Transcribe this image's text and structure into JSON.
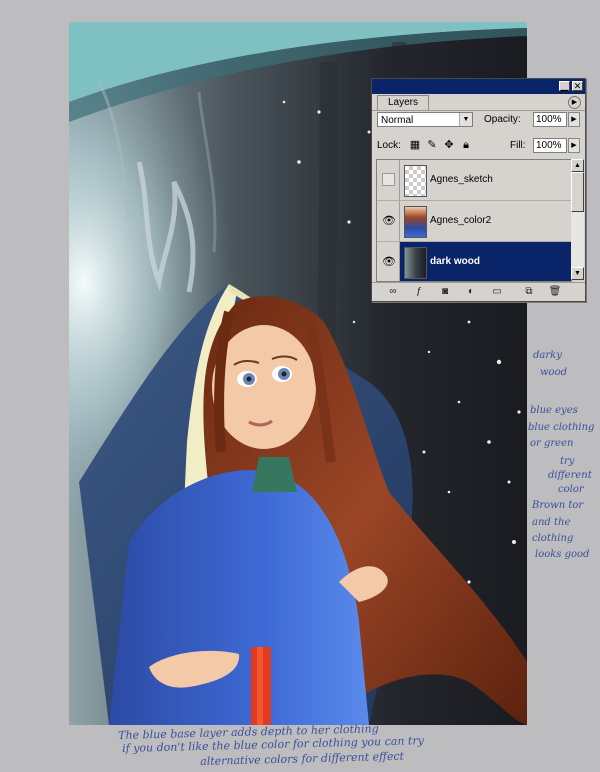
{
  "layers_panel": {
    "tab_label": "Layers",
    "blend_mode": "Normal",
    "opacity_label": "Opacity:",
    "opacity_value": "100%",
    "lock_label": "Lock:",
    "fill_label": "Fill:",
    "fill_value": "100%",
    "layers": [
      {
        "name": "Agnes_sketch",
        "visible": false,
        "selected": false,
        "thumb": "checker"
      },
      {
        "name": "Agnes_color2",
        "visible": true,
        "selected": false,
        "thumb": "portrait"
      },
      {
        "name": "dark wood",
        "visible": true,
        "selected": true,
        "thumb": "forest"
      }
    ],
    "footer_icons": [
      "link-icon",
      "layer-style-icon",
      "mask-icon",
      "adjustment-icon",
      "folder-icon",
      "new-layer-icon",
      "trash-icon"
    ]
  },
  "side_notes": [
    "darky",
    "wood",
    "blue eyes",
    "blue clothing",
    "or green",
    "try",
    "different",
    "color",
    "Brown tor",
    "and the",
    "clothing",
    "looks good"
  ],
  "bottom_notes": [
    "The blue base layer adds depth to her clothing",
    "if you don't like the blue color for clothing you can try",
    "alternative colors for different effect"
  ]
}
